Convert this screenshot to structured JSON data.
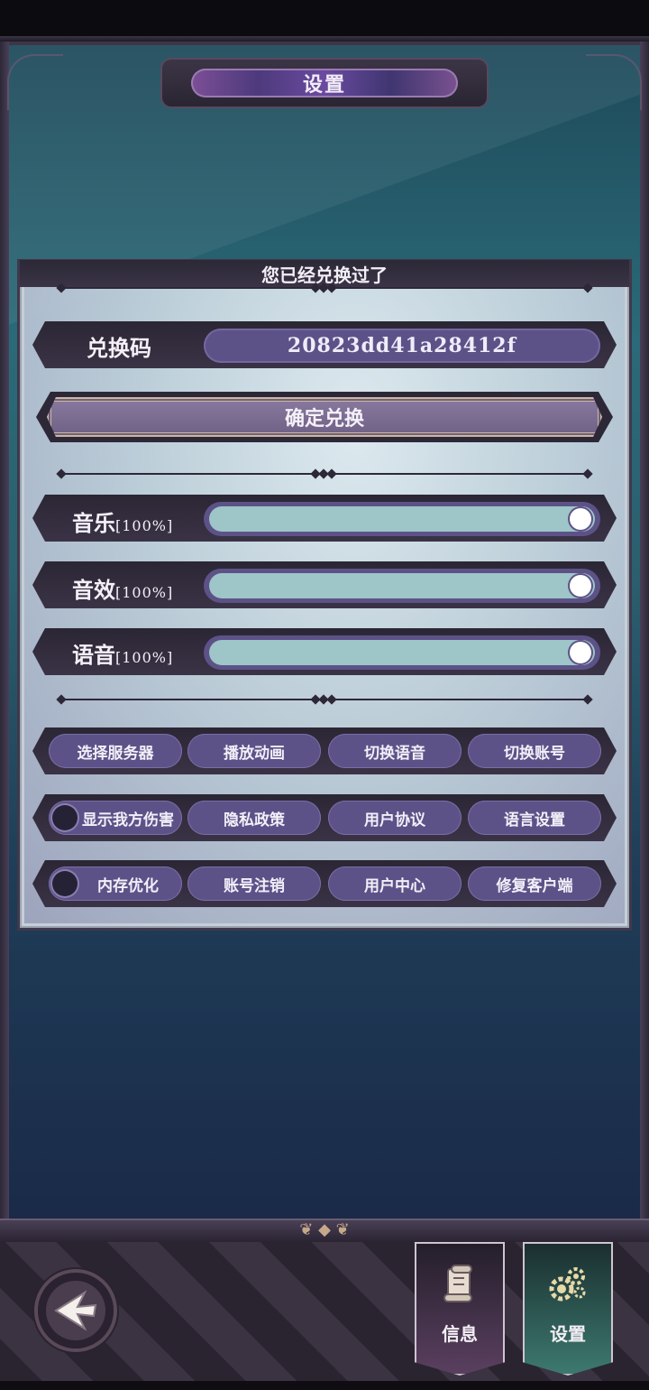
{
  "header": {
    "title": "设置"
  },
  "panel": {
    "status_message": "您已经兑换过了",
    "redeem": {
      "label": "兑换码",
      "code_value": "20823dd41a28412f",
      "confirm_label": "确定兑换"
    },
    "volume": [
      {
        "name": "音乐",
        "percent_text": "[100%]",
        "level": 1.0
      },
      {
        "name": "音效",
        "percent_text": "[100%]",
        "level": 1.0
      },
      {
        "name": "语音",
        "percent_text": "[100%]",
        "level": 1.0
      }
    ],
    "buttons_row1": [
      "选择服务器",
      "播放动画",
      "切换语音",
      "切换账号"
    ],
    "buttons_row2": {
      "toggle_label": "显示我方伤害",
      "toggle_on": false,
      "items": [
        "隐私政策",
        "用户协议",
        "语言设置"
      ]
    },
    "buttons_row3": {
      "toggle_label": "内存优化",
      "toggle_on": false,
      "items": [
        "账号注销",
        "用户中心",
        "修复客户端"
      ]
    }
  },
  "bottom_nav": {
    "tabs": [
      {
        "label": "信息",
        "icon": "scroll-icon",
        "active": false
      },
      {
        "label": "设置",
        "icon": "gears-icon",
        "active": true
      }
    ],
    "back_icon": "back-arrow-icon"
  },
  "colors": {
    "pill": "#5d5288",
    "slider_fill": "#9ec5c7",
    "panel_dark": "#2b2634",
    "active_tab": "#3d7a70"
  }
}
